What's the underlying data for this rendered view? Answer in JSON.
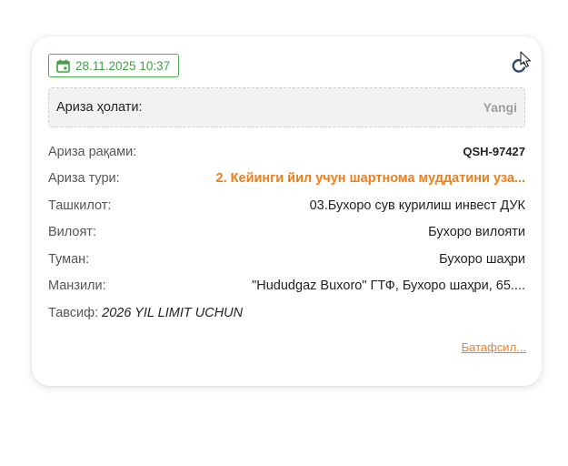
{
  "card": {
    "date": "28.11.2025 10:37",
    "status_label": "Ариза ҳолати:",
    "status_value": "Yangi",
    "fields": [
      {
        "label": "Ариза рақами:",
        "value": "QSH-97427"
      },
      {
        "label": "Ариза тури:",
        "value": "2. Кейинги йил учун шартнома муддатини уза..."
      },
      {
        "label": "Ташкилот:",
        "value": "03.Бухоро сув курилиш инвест ДУК"
      },
      {
        "label": "Вилоят:",
        "value": "Бухоро вилояти"
      },
      {
        "label": "Туман:",
        "value": "Бухоро шаҳри"
      },
      {
        "label": "Манзили:",
        "value": "\"Hududgaz Buxoro\" ГТФ, Бухоро шаҳри, 65...."
      }
    ],
    "description_label": "Тавсиф:",
    "description_value": "2026 YIL LIMIT UCHUN",
    "more_link": "Батафсил..."
  },
  "icons": {
    "date": "calendar-icon",
    "refresh": "refresh-icon",
    "cursor": "mouse-pointer-icon"
  },
  "colors": {
    "green": "#43a047",
    "orange": "#ef7d1a",
    "status_gray": "#9e9e9e"
  }
}
